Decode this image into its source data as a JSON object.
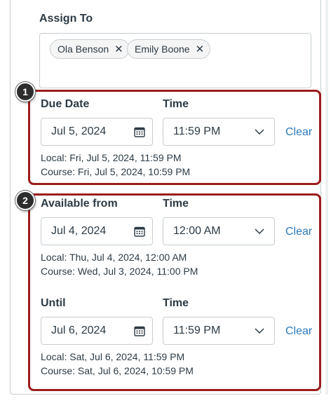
{
  "assign": {
    "label": "Assign To",
    "chips": [
      "Ola Benson",
      "Emily Boone"
    ],
    "chip_remove": "✕"
  },
  "due": {
    "badge": "1",
    "date_label": "Due Date",
    "time_label": "Time",
    "date_value": "Jul 5, 2024",
    "time_value": "11:59 PM",
    "clear": "Clear",
    "local": "Local: Fri, Jul 5, 2024, 11:59 PM",
    "course": "Course: Fri, Jul 5, 2024, 10:59 PM"
  },
  "available": {
    "badge": "2",
    "date_label": "Available from",
    "time_label": "Time",
    "date_value": "Jul 4, 2024",
    "time_value": "12:00 AM",
    "clear": "Clear",
    "local": "Local: Thu, Jul 4, 2024, 12:00 AM",
    "course": "Course: Wed, Jul 3, 2024, 11:00 PM"
  },
  "until": {
    "date_label": "Until",
    "time_label": "Time",
    "date_value": "Jul 6, 2024",
    "time_value": "11:59 PM",
    "clear": "Clear",
    "local": "Local: Sat, Jul 6, 2024, 11:59 PM",
    "course": "Course: Sat, Jul 6, 2024, 10:59 PM"
  },
  "colors": {
    "highlight": "#9b1c1c",
    "link": "#2b7abc",
    "text": "#2d3b45",
    "border": "#c7cdd1"
  }
}
